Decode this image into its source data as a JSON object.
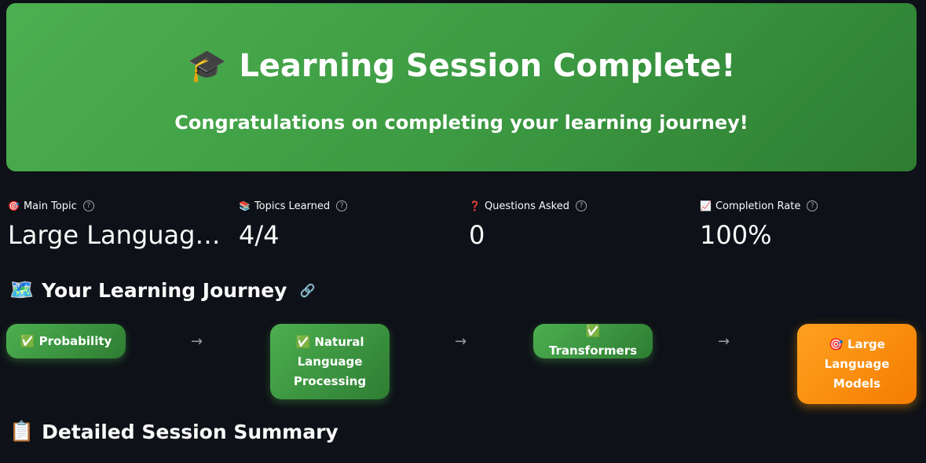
{
  "hero": {
    "icon": "🎓",
    "title": "Learning Session Complete!",
    "subtitle": "Congratulations on completing your learning journey!"
  },
  "metrics": [
    {
      "icon": "🎯",
      "label": "Main Topic",
      "value": "Large Language Models"
    },
    {
      "icon": "📚",
      "label": "Topics Learned",
      "value": "4/4"
    },
    {
      "icon": "❓",
      "label": "Questions Asked",
      "value": "0"
    },
    {
      "icon": "📈",
      "label": "Completion Rate",
      "value": "100%"
    }
  ],
  "help_glyph": "?",
  "journey": {
    "icon": "🗺️",
    "title": "Your Learning Journey",
    "link_icon": "🔗",
    "arrow": "→",
    "steps": [
      {
        "icon": "✅",
        "label": "Probability",
        "status": "completed"
      },
      {
        "icon": "✅",
        "label": "Natural Language Processing",
        "status": "completed"
      },
      {
        "icon": "✅",
        "label": "Transformers",
        "status": "completed"
      },
      {
        "icon": "🎯",
        "label": "Large Language Models",
        "status": "current"
      }
    ]
  },
  "summary": {
    "icon": "📋",
    "title": "Detailed Session Summary"
  },
  "colors": {
    "background": "#0e1117",
    "success_green": "#4caf50",
    "current_orange": "#ff9800"
  }
}
